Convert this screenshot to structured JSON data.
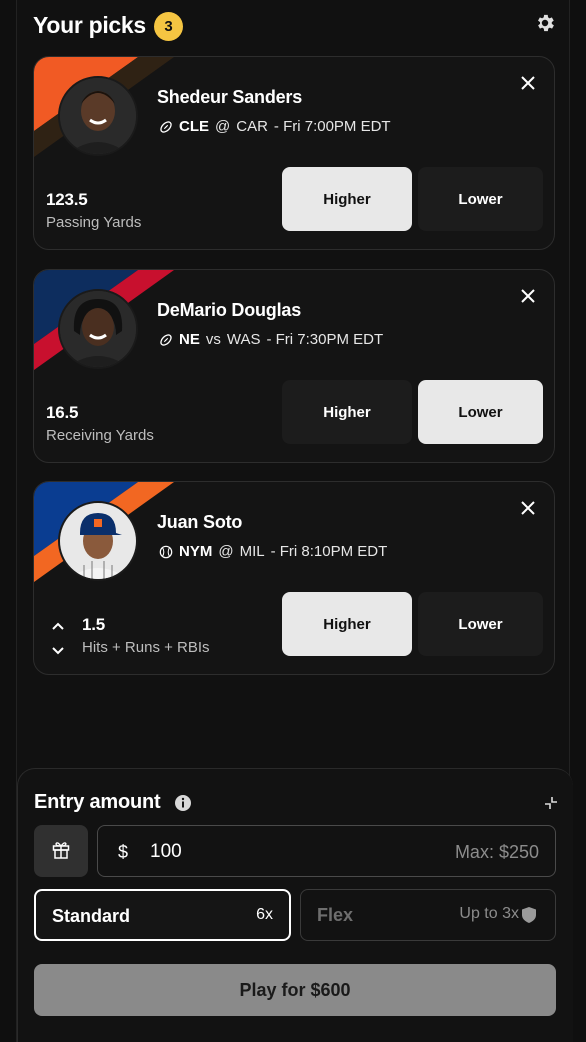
{
  "header": {
    "title": "Your picks",
    "count": "3"
  },
  "picks": [
    {
      "name": "Shedeur Sanders",
      "sport_icon": "football-icon",
      "team": "CLE",
      "separator": "@",
      "opponent": "CAR",
      "time": "- Fri 7:00PM EDT",
      "line_value": "123.5",
      "stat": "Passing Yards",
      "higher_label": "Higher",
      "lower_label": "Lower",
      "selected": "higher",
      "stripe_colors": [
        "#f15a24",
        "#2f2214"
      ]
    },
    {
      "name": "DeMario Douglas",
      "sport_icon": "football-icon",
      "team": "NE",
      "separator": "vs",
      "opponent": "WAS",
      "time": "- Fri 7:30PM EDT",
      "line_value": "16.5",
      "stat": "Receiving Yards",
      "higher_label": "Higher",
      "lower_label": "Lower",
      "selected": "lower",
      "stripe_colors": [
        "#0d2d5e",
        "#c8102e"
      ]
    },
    {
      "name": "Juan Soto",
      "sport_icon": "baseball-icon",
      "team": "NYM",
      "separator": "@",
      "opponent": "MIL",
      "time": "- Fri 8:10PM EDT",
      "line_value": "1.5",
      "stat": "Hits + Runs + RBIs",
      "higher_label": "Higher",
      "lower_label": "Lower",
      "selected": "higher",
      "stripe_colors": [
        "#0a3d91",
        "#f26722"
      ]
    }
  ],
  "entry": {
    "title": "Entry amount",
    "currency": "$",
    "amount": "100",
    "max": "Max: $250",
    "standard_label": "Standard",
    "standard_mult": "6x",
    "flex_label": "Flex",
    "flex_mult": "Up to 3x",
    "play_label": "Play for $600"
  },
  "colors": {
    "badge": "#f5c542",
    "selected_button": "#e8e8e8",
    "play_button": "#8a8a8a"
  }
}
